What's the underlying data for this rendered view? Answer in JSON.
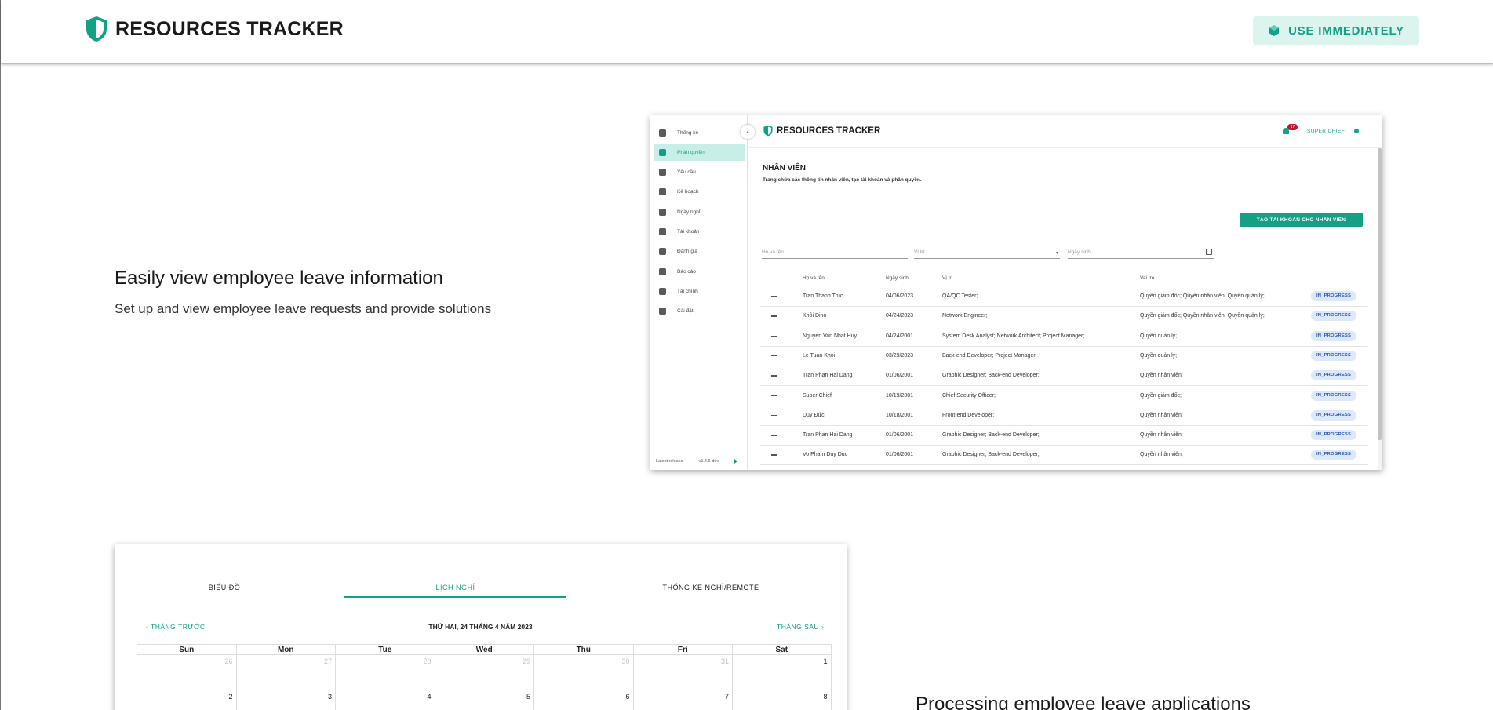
{
  "header": {
    "title": "RESOURCES TRACKER",
    "cta_label": "USE IMMEDIATELY"
  },
  "feature1": {
    "title": "Easily view employee leave information",
    "description": "Set up and view employee leave requests and provide solutions"
  },
  "feature2": {
    "title": "Processing employee leave applications"
  },
  "app_screen": {
    "sidebar": [
      {
        "label": "Thống kê",
        "icon": "bar-chart-icon"
      },
      {
        "label": "Phân quyền",
        "icon": "users-icon",
        "active": true
      },
      {
        "label": "Yêu cầu",
        "icon": "inbox-icon"
      },
      {
        "label": "Kế hoạch",
        "icon": "calendar-icon"
      },
      {
        "label": "Ngày nghỉ",
        "icon": "plane-icon"
      },
      {
        "label": "Tài khoản",
        "icon": "account-icon"
      },
      {
        "label": "Đánh giá",
        "icon": "star-icon"
      },
      {
        "label": "Báo cáo",
        "icon": "report-icon"
      },
      {
        "label": "Tài chính",
        "icon": "finance-icon"
      },
      {
        "label": "Cài đặt",
        "icon": "gear-icon"
      }
    ],
    "release_label": "Latest release",
    "release_version": "v1.4.6-dev",
    "brand": "RESOURCES TRACKER",
    "notification_count": "17",
    "user_name": "SUPER CHIEF",
    "page_title": "NHÂN VIÊN",
    "page_subtitle": "Trang chứa các thông tin nhân viên, tạo tài khoản và phân quyền.",
    "create_button": "TẠO TÀI KHOẢN CHO NHÂN VIÊN",
    "filters": {
      "name_placeholder": "Họ và tên",
      "position_placeholder": "Vị trí",
      "birthday_placeholder": "Ngày sinh"
    },
    "columns": [
      "Họ và tên",
      "Ngày sinh",
      "Vị trí",
      "Vai trò"
    ],
    "rows": [
      {
        "name": "Tran Thanh Truc",
        "birthday": "04/06/2023",
        "position": "QA/QC Tester;",
        "role": "Quyền giám đốc; Quyền nhân viên; Quyền quản lý;",
        "status": "IN_PROGRESS"
      },
      {
        "name": "Khôi Dino",
        "birthday": "04/24/2023",
        "position": "Network Engineer;",
        "role": "Quyền giám đốc; Quyền nhân viên; Quyền quản lý;",
        "status": "IN_PROGRESS"
      },
      {
        "name": "Nguyen Van Nhat Huy",
        "birthday": "04/24/2001",
        "position": "System Desk Analyst; Network Architect; Project Manager;",
        "role": "Quyền quản lý;",
        "status": "IN_PROGRESS"
      },
      {
        "name": "Le Tuan Khoi",
        "birthday": "03/29/2023",
        "position": "Back-end Developer; Project Manager;",
        "role": "Quyền quản lý;",
        "status": "IN_PROGRESS"
      },
      {
        "name": "Tran Phan Hai Dang",
        "birthday": "01/06/2001",
        "position": "Graphic Designer; Back-end Developer;",
        "role": "Quyền nhân viên;",
        "status": "IN_PROGRESS"
      },
      {
        "name": "Super Chief",
        "birthday": "10/19/2001",
        "position": "Chief Security Officer;",
        "role": "Quyền giám đốc;",
        "status": "IN_PROGRESS"
      },
      {
        "name": "Duy Đức",
        "birthday": "10/18/2001",
        "position": "Front-end Developer;",
        "role": "Quyền nhân viên;",
        "status": "IN_PROGRESS"
      },
      {
        "name": "Tran Phan Hai Dang",
        "birthday": "01/06/2001",
        "position": "Graphic Designer; Back-end Developer;",
        "role": "Quyền nhân viên;",
        "status": "IN_PROGRESS"
      },
      {
        "name": "Vo Pham Duy Duc",
        "birthday": "01/06/2001",
        "position": "Graphic Designer; Back-end Developer;",
        "role": "Quyền nhân viên;",
        "status": "IN_PROGRESS"
      }
    ]
  },
  "calendar_screen": {
    "tabs": [
      "BIỂU ĐỒ",
      "LỊCH NGHỈ",
      "THỐNG KÊ NGHỈ/REMOTE"
    ],
    "active_tab": "LỊCH NGHỈ",
    "prev_label": "THÁNG TRƯỚC",
    "next_label": "THÁNG SAU",
    "current_date": "THỨ HAI, 24 THÁNG 4 NĂM 2023",
    "weekdays": [
      "Sun",
      "Mon",
      "Tue",
      "Wed",
      "Thu",
      "Fri",
      "Sat"
    ],
    "weeks": [
      [
        "26",
        "27",
        "28",
        "29",
        "30",
        "31",
        "1"
      ],
      [
        "2",
        "3",
        "4",
        "5",
        "6",
        "7",
        "8"
      ]
    ],
    "muted_first_week_count": 6
  },
  "colors": {
    "accent": "#14a085",
    "accent_light": "#dcf4ee",
    "status_bg": "#dde8fb",
    "status_text": "#2a56b8",
    "badge": "#c4122f"
  }
}
